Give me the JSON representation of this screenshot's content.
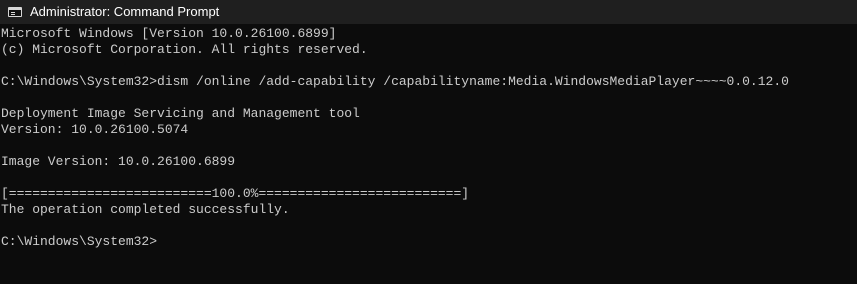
{
  "window": {
    "title": "Administrator: Command Prompt",
    "icon": "command-prompt-icon"
  },
  "terminal": {
    "lines": [
      "Microsoft Windows [Version 10.0.26100.6899]",
      "(c) Microsoft Corporation. All rights reserved.",
      "",
      "C:\\Windows\\System32>dism /online /add-capability /capabilityname:Media.WindowsMediaPlayer~~~~0.0.12.0",
      "",
      "Deployment Image Servicing and Management tool",
      "Version: 10.0.26100.5074",
      "",
      "Image Version: 10.0.26100.6899",
      "",
      "[==========================100.0%==========================]",
      "The operation completed successfully.",
      "",
      "C:\\Windows\\System32>"
    ]
  },
  "colors": {
    "background": "#0c0c0c",
    "titlebar": "#1f1f1f",
    "text": "#cccccc",
    "title_text": "#ffffff"
  }
}
